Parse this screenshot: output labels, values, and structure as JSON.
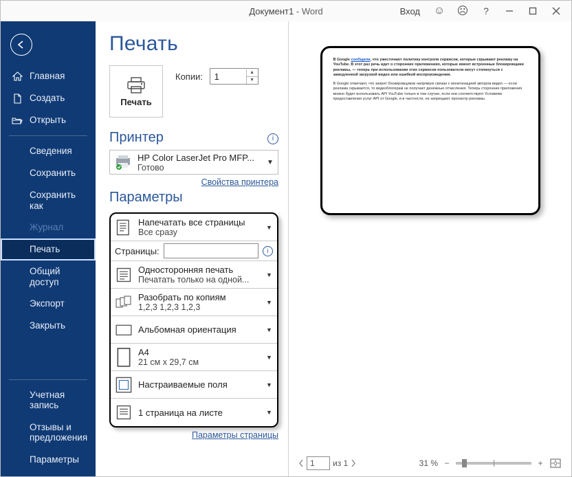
{
  "titlebar": {
    "doc": "Документ1",
    "app": "Word",
    "signin": "Вход"
  },
  "sidebar": {
    "home": "Главная",
    "create": "Создать",
    "open": "Открыть",
    "info": "Сведения",
    "save": "Сохранить",
    "saveas": "Сохранить как",
    "history": "Журнал",
    "print": "Печать",
    "share": "Общий доступ",
    "export": "Экспорт",
    "close": "Закрыть",
    "account": "Учетная запись",
    "feedback": "Отзывы и предложения",
    "options": "Параметры"
  },
  "print": {
    "heading": "Печать",
    "print_button": "Печать",
    "copies_label": "Копии:",
    "copies_value": "1",
    "printer_heading": "Принтер",
    "printer_name": "HP Color LaserJet Pro MFP...",
    "printer_status": "Готово",
    "printer_properties": "Свойства принтера",
    "params_heading": "Параметры",
    "pages_label": "Страницы:",
    "page_settings_link": "Параметры страницы",
    "options": {
      "range": {
        "l1": "Напечатать все страницы",
        "l2": "Все сразу"
      },
      "sides": {
        "l1": "Односторонняя печать",
        "l2": "Печатать только на одной..."
      },
      "collate": {
        "l1": "Разобрать по копиям",
        "l2": "1,2,3    1,2,3    1,2,3"
      },
      "orient": {
        "l1": "Альбомная ориентация",
        "l2": ""
      },
      "size": {
        "l1": "A4",
        "l2": "21 см x 29,7 см"
      },
      "margins": {
        "l1": "Настраиваемые поля",
        "l2": ""
      },
      "perpage": {
        "l1": "1 страница на листе",
        "l2": ""
      }
    }
  },
  "preview": {
    "p1a": "В Google ",
    "p1_link": "сообщили",
    "p1b": ", что ужесточают политику контроля сервисов, которые скрывают рекламу на YouTube. В этот раз речь идет о сторонних приложениях, которые имеют встроенные блокировщики рекламы, — теперь при использовании этих сервисов пользователи могут столкнуться с замедленной загрузкой видео или ошибкой воспроизведения.",
    "p2": "В Google отмечают, что запрет блокировщиков напрямую связан с монетизацией авторов видео — если реклама скрывается, то видеоблогерам не получает денежные отчисления. Теперь сторонние приложения можно будет использовать API YouTube только в том случае, если они соответствуют Условиям предоставления услуг API от Google, и в частности, не запрещают просмотр рекламы."
  },
  "status": {
    "page_value": "1",
    "page_of": "из 1",
    "zoom": "31 %"
  }
}
